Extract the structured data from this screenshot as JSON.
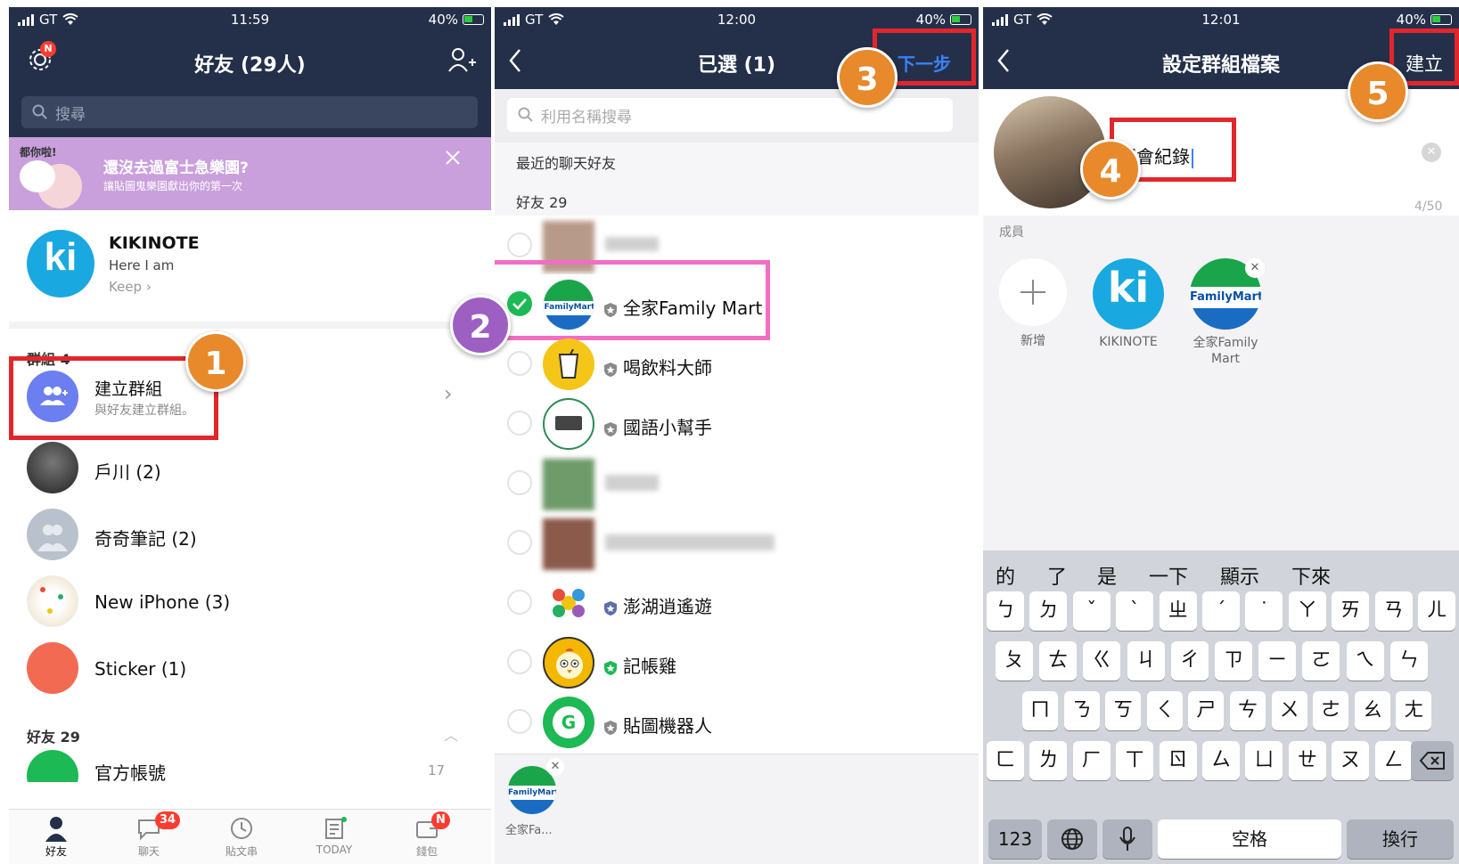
{
  "panel1": {
    "status": {
      "carrier": "GT",
      "time": "11:59",
      "battery": "40%"
    },
    "nav": {
      "title": "好友 (29人)",
      "settings_badge": "N"
    },
    "search": {
      "placeholder": "搜尋"
    },
    "banner": {
      "sticker_text": "都你啦!",
      "title": "還沒去過富士急樂園?",
      "subtitle": "讓貼圖鬼樂園獻出你的第一次"
    },
    "profile": {
      "name": "KIKINOTE",
      "status": "Here I am",
      "keep_label": "Keep"
    },
    "groups_header": "群組 4",
    "create_group": {
      "title": "建立群組",
      "subtitle": "與好友建立群組。"
    },
    "groups": [
      {
        "name": "戶川 (2)"
      },
      {
        "name": "奇奇筆記 (2)"
      },
      {
        "name": "New iPhone (3)"
      },
      {
        "name": "Sticker (1)"
      }
    ],
    "friends_header": "好友 29",
    "partial_row": {
      "name": "官方帳號",
      "count": "17"
    },
    "tabs": [
      {
        "label": "好友",
        "badge": ""
      },
      {
        "label": "聊天",
        "badge": "34"
      },
      {
        "label": "貼文串",
        "badge": ""
      },
      {
        "label": "TODAY",
        "badge": ""
      },
      {
        "label": "錢包",
        "badge": "N"
      }
    ],
    "step_number": "1"
  },
  "panel2": {
    "status": {
      "carrier": "GT",
      "time": "12:00",
      "battery": "40%"
    },
    "nav": {
      "title": "已選 (1)",
      "next_label": "下一步"
    },
    "search": {
      "placeholder": "利用名稱搜尋"
    },
    "recent_header": "最近的聊天好友",
    "friends_header": "好友 29",
    "rows": [
      {
        "name": "",
        "blurred": true
      },
      {
        "name": "全家Family Mart",
        "checked": true
      },
      {
        "name": "喝飲料大師"
      },
      {
        "name": "國語小幫手"
      },
      {
        "name": "",
        "blurred": true
      },
      {
        "name": "",
        "blurred": true
      },
      {
        "name": "澎湖逍遙遊"
      },
      {
        "name": "記帳雞"
      },
      {
        "name": "貼圖機器人"
      }
    ],
    "familymart_logo": "FamilyMart",
    "selected_label": "全家Fa...",
    "step2": "2",
    "step3": "3"
  },
  "panel3": {
    "status": {
      "carrier": "GT",
      "time": "12:01",
      "battery": "40%"
    },
    "nav": {
      "title": "設定群組檔案",
      "create_label": "建立"
    },
    "group_name": "開會紀錄",
    "char_count": "4/50",
    "members_header": "成員",
    "members": [
      {
        "label": "新增"
      },
      {
        "label": "KIKINOTE"
      },
      {
        "label": "全家Family Mart"
      }
    ],
    "familymart_logo": "FamilyMart",
    "step4": "4",
    "step5": "5",
    "keyboard": {
      "candidates": [
        "的",
        "了",
        "是",
        "一下",
        "顯示",
        "下來"
      ],
      "row1": [
        "ㄅ",
        "ㄉ",
        "ˇ",
        "ˋ",
        "ㄓ",
        "ˊ",
        "˙",
        "ㄚ",
        "ㄞ",
        "ㄢ",
        "ㄦ"
      ],
      "row2": [
        "ㄆ",
        "ㄊ",
        "ㄍ",
        "ㄐ",
        "ㄔ",
        "ㄗ",
        "ㄧ",
        "ㄛ",
        "ㄟ",
        "ㄣ"
      ],
      "row3": [
        "ㄇ",
        "ㄋ",
        "ㄎ",
        "ㄑ",
        "ㄕ",
        "ㄘ",
        "ㄨ",
        "ㄜ",
        "ㄠ",
        "ㄤ"
      ],
      "row4": [
        "ㄈ",
        "ㄌ",
        "ㄏ",
        "ㄒ",
        "ㄖ",
        "ㄙ",
        "ㄩ",
        "ㄝ",
        "ㄡ",
        "ㄥ"
      ],
      "num_key": "123",
      "space_key": "空格",
      "return_key": "換行"
    }
  }
}
